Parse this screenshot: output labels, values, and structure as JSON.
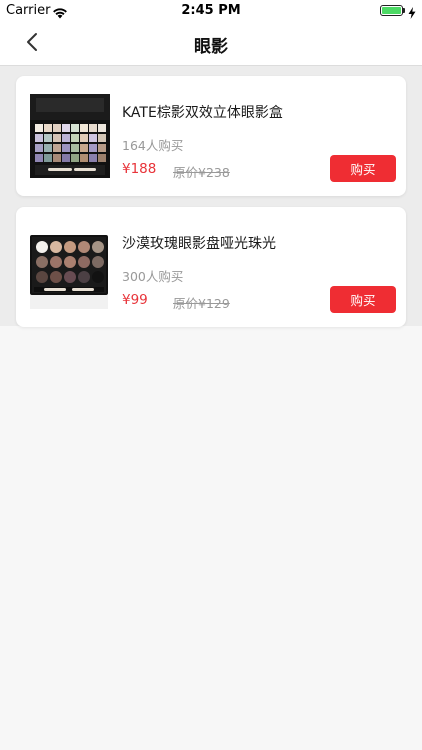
{
  "status_bar": {
    "carrier": "Carrier",
    "time": "2:45 PM",
    "wifi_icon": "wifi-icon",
    "battery_icon": "battery-icon",
    "charging_icon": "bolt-icon",
    "battery_level": 1.0,
    "battery_color": "#4cd964"
  },
  "nav": {
    "title": "眼影",
    "back_icon": "chevron-left-icon"
  },
  "products": [
    {
      "name": "KATE棕影双效立体眼影盒",
      "sold": "164人购买",
      "price": "¥188",
      "original_price": "原价¥238",
      "buy_label": "购买"
    },
    {
      "name": "沙漠玫瑰眼影盘哑光珠光",
      "sold": "300人购买",
      "price": "¥99",
      "original_price": "原价¥129",
      "buy_label": "购买"
    }
  ],
  "colors": {
    "accent": "#ef2d33",
    "price": "#e8343a",
    "muted": "#999999"
  }
}
